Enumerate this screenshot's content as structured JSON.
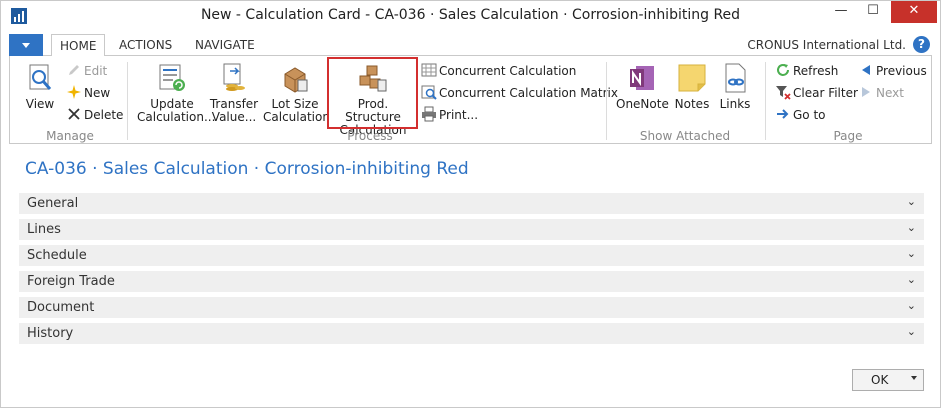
{
  "window": {
    "title": "New - Calculation Card - CA-036 · Sales Calculation · Corrosion-inhibiting Red",
    "minimize": "—",
    "maximize": "☐",
    "close": "✕"
  },
  "ribbon": {
    "tabs": [
      {
        "label": "HOME",
        "active": true
      },
      {
        "label": "ACTIONS",
        "active": false
      },
      {
        "label": "NAVIGATE",
        "active": false
      }
    ],
    "company": "CRONUS International Ltd.",
    "help": "?",
    "groups": {
      "manage": {
        "label": "Manage",
        "view": "View",
        "edit": "Edit",
        "new": "New",
        "delete": "Delete"
      },
      "process": {
        "label": "Process",
        "update_calc_1": "Update",
        "update_calc_2": "Calculation...",
        "transfer_1": "Transfer",
        "transfer_2": "Value...",
        "lot_size_1": "Lot Size",
        "lot_size_2": "Calculation",
        "prod_1": "Prod. Structure",
        "prod_2": "Calculation",
        "concurrent": "Concurrent Calculation",
        "concurrent_matrix": "Concurrent Calculation Matrix",
        "print": "Print..."
      },
      "show_attached": {
        "label": "Show Attached",
        "onenote": "OneNote",
        "notes": "Notes",
        "links": "Links"
      },
      "page": {
        "label": "Page",
        "refresh": "Refresh",
        "clear_filter": "Clear Filter",
        "go_to": "Go to",
        "previous": "Previous",
        "next": "Next"
      }
    }
  },
  "card": {
    "title": "CA-036 · Sales Calculation · Corrosion-inhibiting Red",
    "fasttabs": [
      "General",
      "Lines",
      "Schedule",
      "Foreign Trade",
      "Document",
      "History"
    ]
  },
  "footer": {
    "ok": "OK"
  },
  "colors": {
    "accent": "#2f73c4",
    "highlight": "#d32f2f",
    "close_button": "#c7312a"
  }
}
